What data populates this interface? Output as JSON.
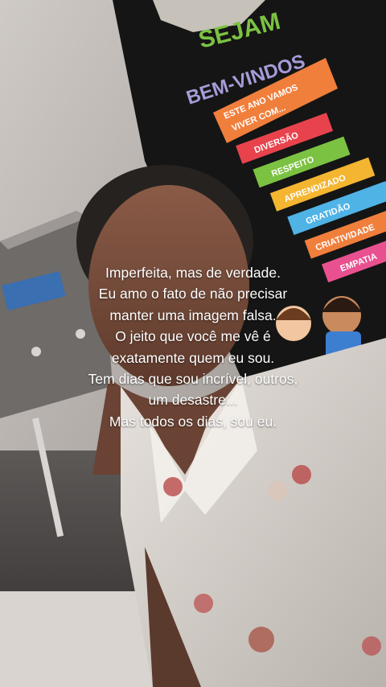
{
  "poster": {
    "greeting_top": "SEJAM",
    "greeting_bottom": "BEM-VINDOS",
    "arrow_heading_line1": "ESTE ANO VAMOS",
    "arrow_heading_line2": "VIVER COM...",
    "values": [
      "DIVERSÃO",
      "RESPEITO",
      "APRENDIZADO",
      "GRATIDÃO",
      "CRIATIVIDADE",
      "EMPATIA"
    ],
    "value_colors": [
      "#e8434d",
      "#7cc242",
      "#f4b531",
      "#4fb3e6",
      "#f07f3c",
      "#e9508f"
    ]
  },
  "caption": {
    "lines": [
      "Imperfeita, mas de verdade.",
      "Eu amo o fato de não precisar",
      "manter uma imagem falsa.",
      "O jeito que você me vê é",
      "exatamente quem eu sou.",
      "Tem dias que sou incrível, outros,",
      "um desastre...",
      "Mas todos os dias, sou eu."
    ]
  }
}
